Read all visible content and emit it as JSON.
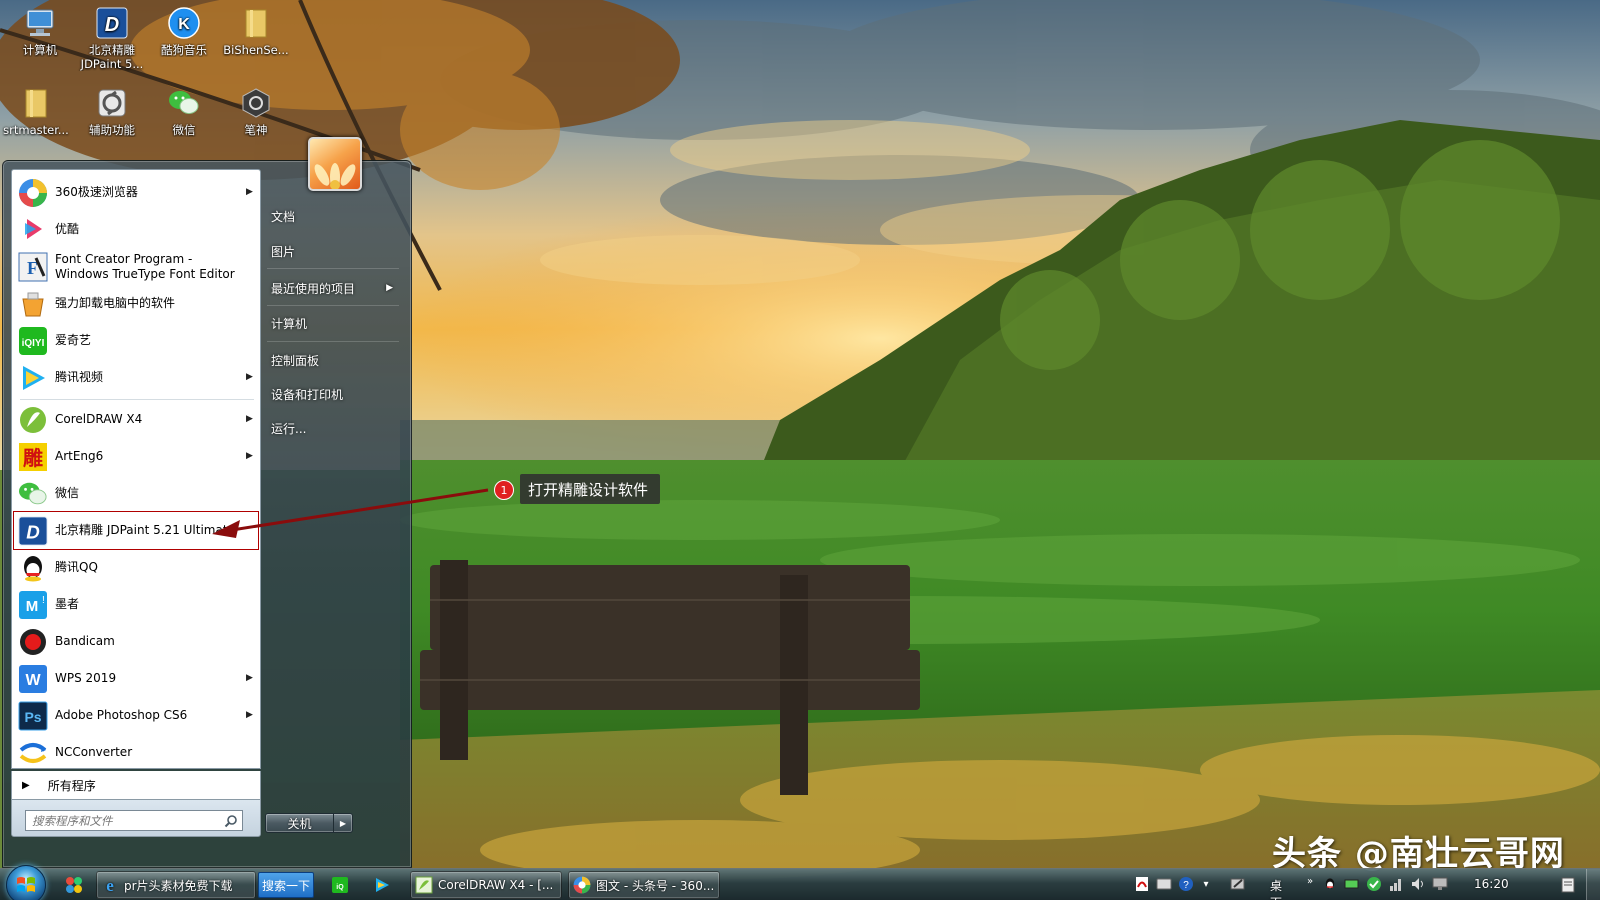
{
  "desktop": {
    "icons": [
      {
        "label": "计算机",
        "label2": "",
        "icon": "computer-icon"
      },
      {
        "label": "北京精雕",
        "label2": "JDPaint 5...",
        "icon": "jdpaint-icon"
      },
      {
        "label": "酷狗音乐",
        "label2": "",
        "icon": "kugou-icon"
      },
      {
        "label": "BiShenSe...",
        "label2": "",
        "icon": "folder-icon"
      },
      {
        "label": "srtmaster...",
        "label2": "",
        "icon": "folder-icon"
      },
      {
        "label": "辅助功能",
        "label2": "",
        "icon": "accessibility-icon"
      },
      {
        "label": "微信",
        "label2": "",
        "icon": "wechat-icon"
      },
      {
        "label": "笔神",
        "label2": "",
        "icon": "bishen-icon"
      }
    ]
  },
  "start_menu": {
    "programs": [
      {
        "label": "360极速浏览器",
        "has_submenu": true,
        "icon": "360-browser-icon"
      },
      {
        "label": "优酷",
        "has_submenu": false,
        "icon": "youku-icon"
      },
      {
        "label": "Font Creator Program -",
        "label2": "Windows TrueType Font Editor",
        "has_submenu": false,
        "icon": "font-creator-icon"
      },
      {
        "label": "强力卸载电脑中的软件",
        "has_submenu": false,
        "icon": "uninstaller-icon"
      },
      {
        "label": "爱奇艺",
        "has_submenu": false,
        "icon": "iqiyi-icon"
      },
      {
        "label": "腾讯视频",
        "has_submenu": true,
        "icon": "tencent-video-icon"
      },
      {
        "label": "CorelDRAW X4",
        "has_submenu": true,
        "icon": "coreldraw-icon"
      },
      {
        "label": "ArtEng6",
        "has_submenu": true,
        "icon": "arteng-icon"
      },
      {
        "label": "微信",
        "has_submenu": false,
        "icon": "wechat-icon"
      },
      {
        "label": "北京精雕 JDPaint 5.21 Ultimate",
        "has_submenu": false,
        "icon": "jdpaint-icon",
        "highlighted": true
      },
      {
        "label": "腾讯QQ",
        "has_submenu": false,
        "icon": "qq-icon"
      },
      {
        "label": "墨者",
        "has_submenu": false,
        "icon": "mozhe-icon"
      },
      {
        "label": "Bandicam",
        "has_submenu": false,
        "icon": "bandicam-icon"
      },
      {
        "label": "WPS 2019",
        "has_submenu": true,
        "icon": "wps-icon"
      },
      {
        "label": "Adobe Photoshop CS6",
        "has_submenu": true,
        "icon": "photoshop-icon"
      },
      {
        "label": "NCConverter",
        "has_submenu": false,
        "icon": "ncconverter-icon"
      }
    ],
    "all_programs": "所有程序",
    "search_placeholder": "搜索程序和文件",
    "right_items": [
      {
        "label": "文档",
        "has_submenu": false
      },
      {
        "label": "图片",
        "has_submenu": false
      },
      {
        "label": "最近使用的项目",
        "has_submenu": true
      },
      {
        "label": "计算机",
        "has_submenu": false
      },
      {
        "label": "控制面板",
        "has_submenu": false
      },
      {
        "label": "设备和打印机",
        "has_submenu": false
      },
      {
        "label": "运行...",
        "has_submenu": false
      }
    ],
    "shutdown_label": "关机",
    "shutdown_arrow": "▶"
  },
  "annotation": {
    "badge": "1",
    "text": "打开精雕设计软件"
  },
  "watermark": "头条 @南壮云哥网",
  "taskbar": {
    "buttons": [
      {
        "label": "pr片头素材免费下载",
        "icon": "ie-icon"
      },
      {
        "label": "CorelDRAW X4 - [...",
        "icon": "coreldraw-icon"
      },
      {
        "label": "图文 - 头条号 - 360...",
        "icon": "360-browser-icon"
      }
    ],
    "search_button": "搜索一下",
    "tray_desktop": "桌面",
    "tray_chevron": "»",
    "clock": "16:20"
  },
  "colors": {
    "highlight_border": "#b00000",
    "annotation_badge": "#e02020",
    "annotation_bg": "#303030"
  }
}
